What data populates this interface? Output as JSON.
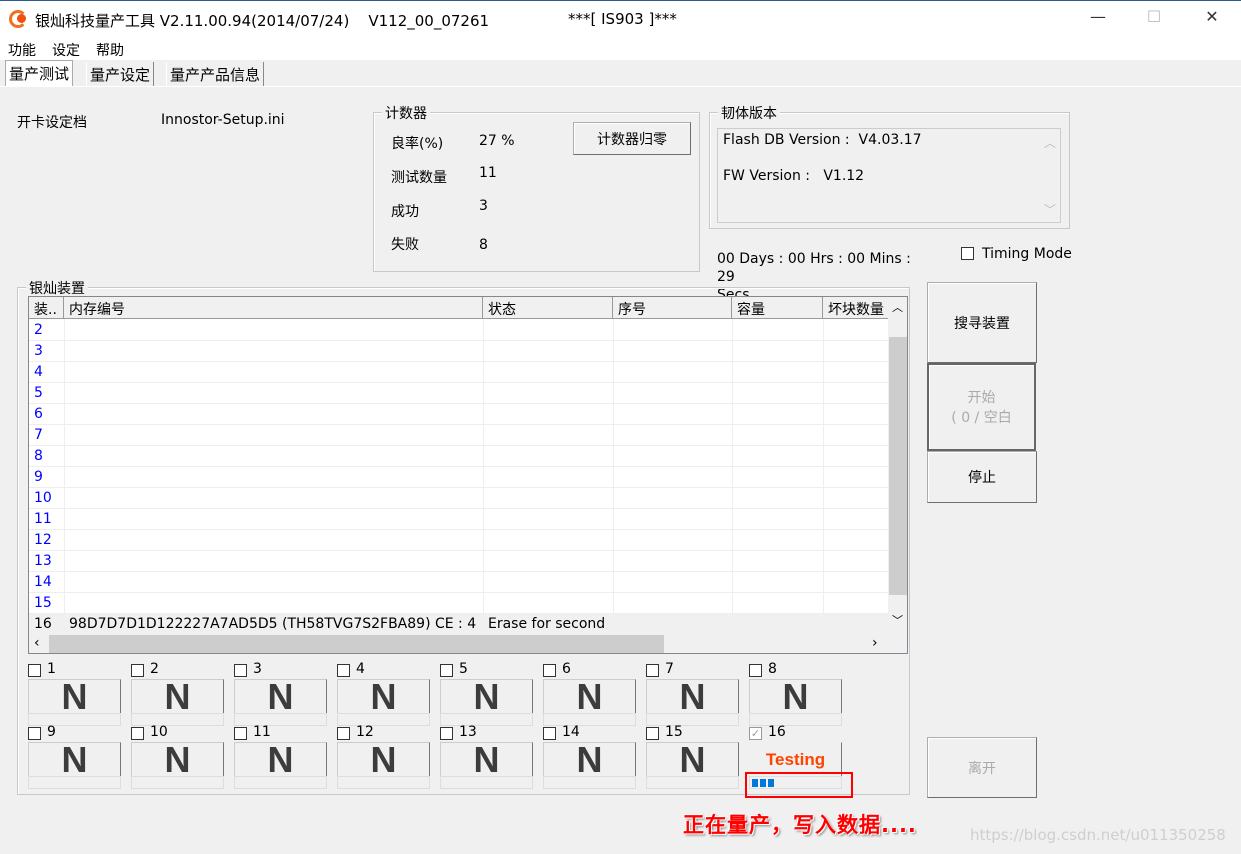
{
  "window": {
    "title": "银灿科技量产工具 V2.11.00.94(2014/07/24)    V112_00_07261",
    "ic": "***[ IS903 ]***",
    "controls": [
      "—",
      "☐",
      "✕"
    ]
  },
  "menu": [
    "功能",
    "设定",
    "帮助"
  ],
  "tabs": [
    "量产测试",
    "量产设定",
    "量产产品信息"
  ],
  "config": {
    "label": "开卡设定档",
    "value": "Innostor-Setup.ini"
  },
  "counter": {
    "title": "计数器",
    "reset_button": "计数器归零",
    "items": [
      {
        "label": "良率(%)",
        "value": "27 %"
      },
      {
        "label": "测试数量",
        "value": "11"
      },
      {
        "label": "成功",
        "value": "3"
      },
      {
        "label": "失败",
        "value": "8"
      }
    ]
  },
  "firmware": {
    "title": "韧体版本",
    "flash_db": "Flash DB Version :  V4.03.17",
    "fw": "FW Version :   V1.12"
  },
  "timer": {
    "text": "00 Days : 00 Hrs : 00 Mins : 29",
    "secs": "Secs"
  },
  "timing_mode": {
    "label": "Timing Mode",
    "checked": false
  },
  "devices": {
    "title": "银灿装置",
    "columns": [
      "装..",
      "内存编号",
      "状态",
      "序号",
      "容量",
      "坏块数量"
    ],
    "rows": [
      {
        "no": "2"
      },
      {
        "no": "3"
      },
      {
        "no": "4"
      },
      {
        "no": "5"
      },
      {
        "no": "6"
      },
      {
        "no": "7"
      },
      {
        "no": "8"
      },
      {
        "no": "9"
      },
      {
        "no": "10"
      },
      {
        "no": "11"
      },
      {
        "no": "12"
      },
      {
        "no": "13"
      },
      {
        "no": "14"
      },
      {
        "no": "15"
      },
      {
        "no": "16",
        "memory": "98D7D7D1D122227A7AD5D5 (TH58TVG7S2FBA89) CE : 4",
        "status": "Erase for second"
      }
    ]
  },
  "buttons": {
    "search": "搜寻装置",
    "start_line1": "开始",
    "start_line2": "( 0 / 空白",
    "stop": "停止",
    "exit": "离开"
  },
  "slots": [
    {
      "n": "1",
      "s": "N"
    },
    {
      "n": "2",
      "s": "N"
    },
    {
      "n": "3",
      "s": "N"
    },
    {
      "n": "4",
      "s": "N"
    },
    {
      "n": "5",
      "s": "N"
    },
    {
      "n": "6",
      "s": "N"
    },
    {
      "n": "7",
      "s": "N"
    },
    {
      "n": "8",
      "s": "N"
    },
    {
      "n": "9",
      "s": "N"
    },
    {
      "n": "10",
      "s": "N"
    },
    {
      "n": "11",
      "s": "N"
    },
    {
      "n": "12",
      "s": "N"
    },
    {
      "n": "13",
      "s": "N"
    },
    {
      "n": "14",
      "s": "N"
    },
    {
      "n": "15",
      "s": "N"
    },
    {
      "n": "16",
      "s": "Testing",
      "checked": true,
      "progress": 0.25
    }
  ],
  "colors": {
    "testing": "#ff4400",
    "progress": "#0078d7",
    "annotation": "#ff0000",
    "row_number": "#0000ff"
  },
  "annotation": "正在量产，写入数据....",
  "watermark": "https://blog.csdn.net/u011350258"
}
